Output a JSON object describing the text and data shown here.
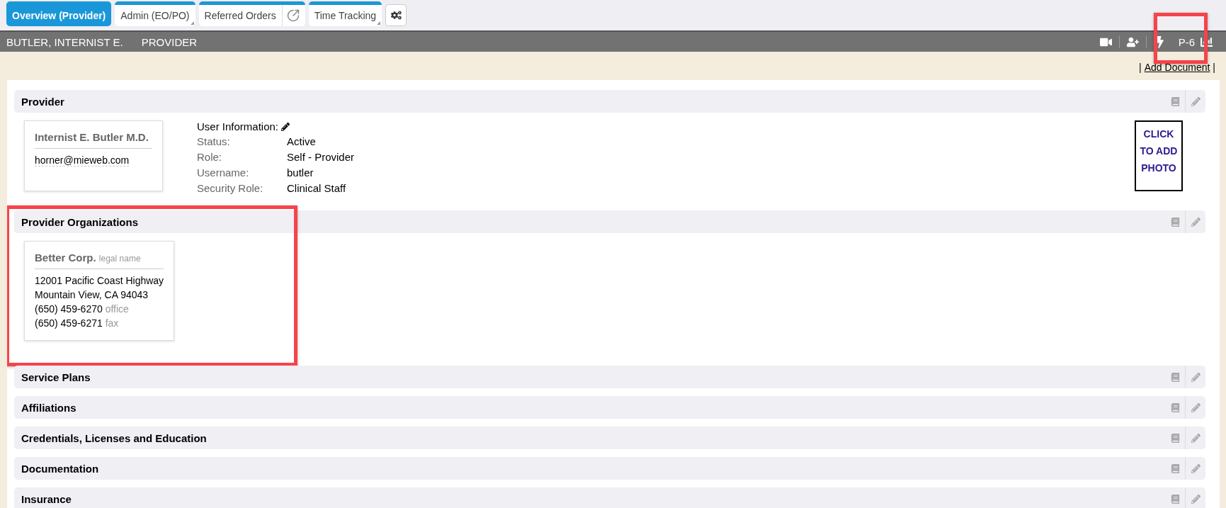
{
  "tabs": [
    {
      "label": "Overview (Provider)",
      "selected": true,
      "kind": "plain"
    },
    {
      "label": "Admin (EO/PO)",
      "selected": false,
      "kind": "menu"
    },
    {
      "label": "Referred Orders",
      "selected": false,
      "kind": "link"
    },
    {
      "label": "Time Tracking",
      "selected": false,
      "kind": "menu"
    }
  ],
  "patient_bar": {
    "name": "BUTLER, INTERNIST E.",
    "role": "PROVIDER",
    "badge": "P-6",
    "highlighted": true
  },
  "document_link": {
    "before": "|",
    "label": "Add Document",
    "after": "|"
  },
  "sections": [
    {
      "title": "Provider",
      "kind": "provider",
      "highlighted": false,
      "card": {
        "name": "Internist E. Butler M.D.",
        "email": "horner@mieweb.com"
      },
      "user_info": {
        "label": "User Information:",
        "fields": [
          {
            "label": "Status:",
            "value": "Active"
          },
          {
            "label": "Role:",
            "value": "Self - Provider"
          },
          {
            "label": "Username:",
            "value": "butler"
          },
          {
            "label": "Security Role:",
            "value": "Clinical Staff"
          }
        ]
      },
      "photo": "CLICK TO ADD PHOTO"
    },
    {
      "title": "Provider Organizations",
      "kind": "organizations",
      "highlighted": true,
      "card": {
        "name": "Better Corp.",
        "name_note": "legal name",
        "lines": [
          "12001 Pacific Coast Highway",
          "Mountain View, CA 94043"
        ],
        "phones": [
          {
            "number": "(650) 459-6270",
            "type": "office"
          },
          {
            "number": "(650) 459-6271",
            "type": "fax"
          }
        ]
      }
    },
    {
      "title": "Service Plans",
      "kind": "empty",
      "highlighted": false
    },
    {
      "title": "Affiliations",
      "kind": "empty",
      "highlighted": false
    },
    {
      "title": "Credentials, Licenses and Education",
      "kind": "empty",
      "highlighted": false
    },
    {
      "title": "Documentation",
      "kind": "empty",
      "highlighted": false
    },
    {
      "title": "Insurance",
      "kind": "empty",
      "highlighted": false
    }
  ]
}
